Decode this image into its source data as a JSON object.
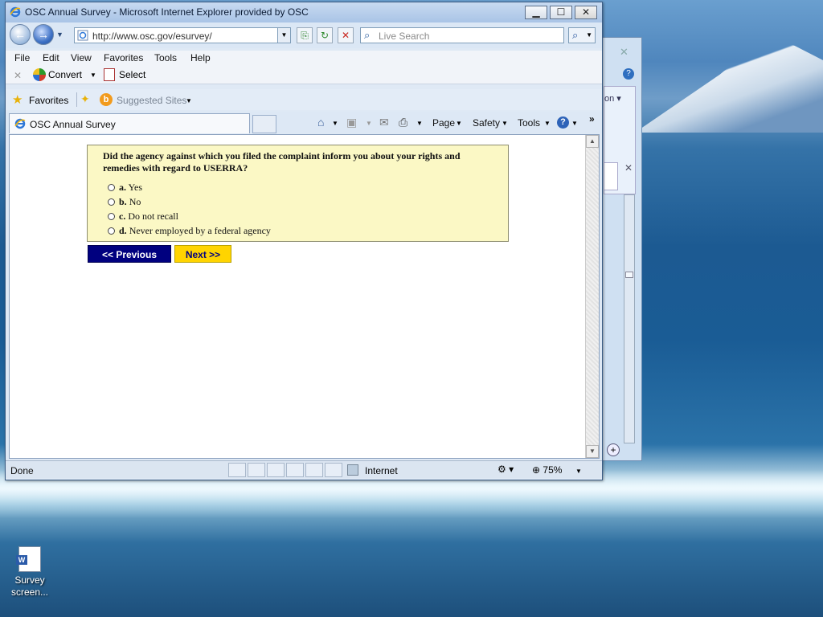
{
  "window": {
    "title": "OSC Annual Survey - Microsoft Internet Explorer provided by OSC",
    "minimize": "▁",
    "maximize": "☐",
    "close": "✕"
  },
  "address": {
    "url": "http://www.osc.gov/esurvey/",
    "search_placeholder": "Live Search"
  },
  "menu": {
    "items": [
      "File",
      "Edit",
      "View",
      "Favorites",
      "Tools",
      "Help"
    ]
  },
  "command_bar": {
    "close": "✕",
    "convert": "Convert",
    "select": "Select"
  },
  "favorites_bar": {
    "favorites": "Favorites",
    "suggested_sites": "Suggested Sites"
  },
  "tab": {
    "label": "OSC Annual Survey"
  },
  "toolbar": {
    "page": "Page",
    "safety": "Safety",
    "tools": "Tools",
    "more": "»"
  },
  "survey": {
    "question": "Did the agency against which you filed the complaint inform you about your rights and remedies with regard to USERRA?",
    "options": [
      {
        "letter": "a.",
        "text": "Yes"
      },
      {
        "letter": "b.",
        "text": "No"
      },
      {
        "letter": "c.",
        "text": "Do not recall"
      },
      {
        "letter": "d.",
        "text": "Never employed by a federal agency"
      }
    ],
    "previous_label": "<< Previous",
    "next_label": "Next >>"
  },
  "status_bar": {
    "status": "Done",
    "zone": "Internet",
    "zoom": "75%"
  },
  "desktop": {
    "icon_label": "Survey screen..."
  },
  "colors": {
    "question_bg": "#fbf8c5",
    "prev_button": "#00007f",
    "next_button": "#ffd400"
  }
}
